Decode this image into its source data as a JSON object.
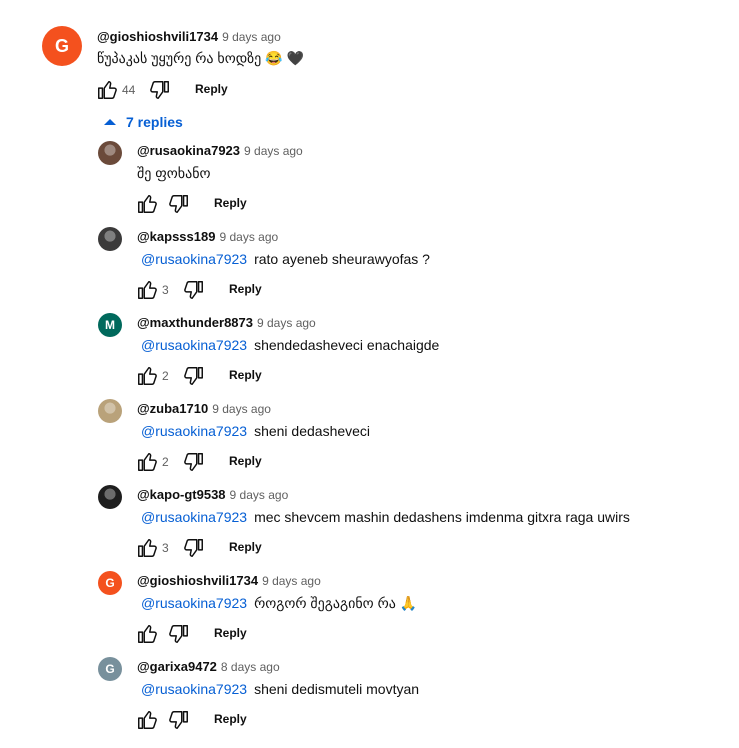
{
  "top_comment": {
    "avatar_letter": "G",
    "avatar_color": "#f4511e",
    "author": "@gioshioshvili1734",
    "time": "9 days ago",
    "text": "წუპაკას უყურე რა ხოდზე 😂 🖤",
    "likes": "44",
    "reply_label": "Reply"
  },
  "replies_toggle": {
    "label": "7 replies",
    "accent": "#065fd4"
  },
  "replies": [
    {
      "author": "@rusaokina7923",
      "time": "9 days ago",
      "mention": "",
      "text": "შე ფოხანო",
      "likes": "",
      "reply_label": "Reply",
      "avatar": {
        "type": "photo",
        "color": "#6b4a3a"
      }
    },
    {
      "author": "@kapsss189",
      "time": "9 days ago",
      "mention": "@rusaokina7923",
      "text": "rato ayeneb sheurawyofas ?",
      "likes": "3",
      "reply_label": "Reply",
      "avatar": {
        "type": "photo",
        "color": "#3b3a3a"
      }
    },
    {
      "author": "@maxthunder8873",
      "time": "9 days ago",
      "mention": "@rusaokina7923",
      "text": "shendedasheveci enachaigde",
      "likes": "2",
      "reply_label": "Reply",
      "avatar": {
        "type": "letter",
        "letter": "M",
        "color": "#00695c"
      }
    },
    {
      "author": "@zuba1710",
      "time": "9 days ago",
      "mention": "@rusaokina7923",
      "text": "sheni dedasheveci",
      "likes": "2",
      "reply_label": "Reply",
      "avatar": {
        "type": "photo",
        "color": "#b9a27a"
      }
    },
    {
      "author": "@kapo-gt9538",
      "time": "9 days ago",
      "mention": "@rusaokina7923",
      "text": "mec shevcem mashin dedashens imdenma gitxra raga uwirs",
      "likes": "3",
      "reply_label": "Reply",
      "avatar": {
        "type": "photo",
        "color": "#1e1e1e"
      }
    },
    {
      "author": "@gioshioshvili1734",
      "time": "9 days ago",
      "mention": "@rusaokina7923",
      "text": "როგორ შეგაგინო რა 🙏",
      "likes": "",
      "reply_label": "Reply",
      "avatar": {
        "type": "letter",
        "letter": "G",
        "color": "#f4511e"
      }
    },
    {
      "author": "@garixa9472",
      "time": "8 days ago",
      "mention": "@rusaokina7923",
      "text": "sheni dedismuteli movtyan",
      "likes": "",
      "reply_label": "Reply",
      "avatar": {
        "type": "letter",
        "letter": "G",
        "color": "#78909c"
      }
    }
  ],
  "icons": {
    "like": "thumb-up-icon",
    "dislike": "thumb-down-icon",
    "toggle": "caret-up-icon"
  }
}
